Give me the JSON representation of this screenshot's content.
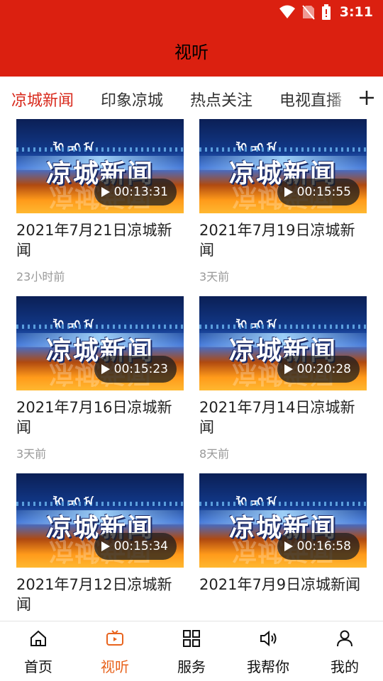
{
  "status_bar": {
    "time": "3:11"
  },
  "header": {
    "title": "视听"
  },
  "tabs": [
    {
      "label": "凉城新闻",
      "active": true
    },
    {
      "label": "印象凉城",
      "active": false
    },
    {
      "label": "热点关注",
      "active": false
    },
    {
      "label": "电视直播",
      "active": false
    }
  ],
  "tab_add_icon": "plus-icon",
  "thumbnail_text": "凉城新闻",
  "videos": [
    {
      "title": "2021年7月21日凉城新闻",
      "time": "23小时前",
      "duration": "00:13:31"
    },
    {
      "title": "2021年7月19日凉城新闻",
      "time": "3天前",
      "duration": "00:15:55"
    },
    {
      "title": "2021年7月16日凉城新闻",
      "time": "3天前",
      "duration": "00:15:23"
    },
    {
      "title": "2021年7月14日凉城新闻",
      "time": "8天前",
      "duration": "00:20:28"
    },
    {
      "title": "2021年7月12日凉城新闻",
      "time": "",
      "duration": "00:15:34"
    },
    {
      "title": "2021年7月9日凉城新闻",
      "time": "",
      "duration": "00:16:58"
    }
  ],
  "bottom_nav": [
    {
      "label": "首页",
      "icon": "home-icon",
      "active": false
    },
    {
      "label": "视听",
      "icon": "tv-icon",
      "active": true
    },
    {
      "label": "服务",
      "icon": "grid-icon",
      "active": false
    },
    {
      "label": "我帮你",
      "icon": "speaker-icon",
      "active": false
    },
    {
      "label": "我的",
      "icon": "user-icon",
      "active": false
    }
  ],
  "colors": {
    "brand_red": "#db2010",
    "active_tab": "#d8281b",
    "active_nav": "#e8631d"
  }
}
